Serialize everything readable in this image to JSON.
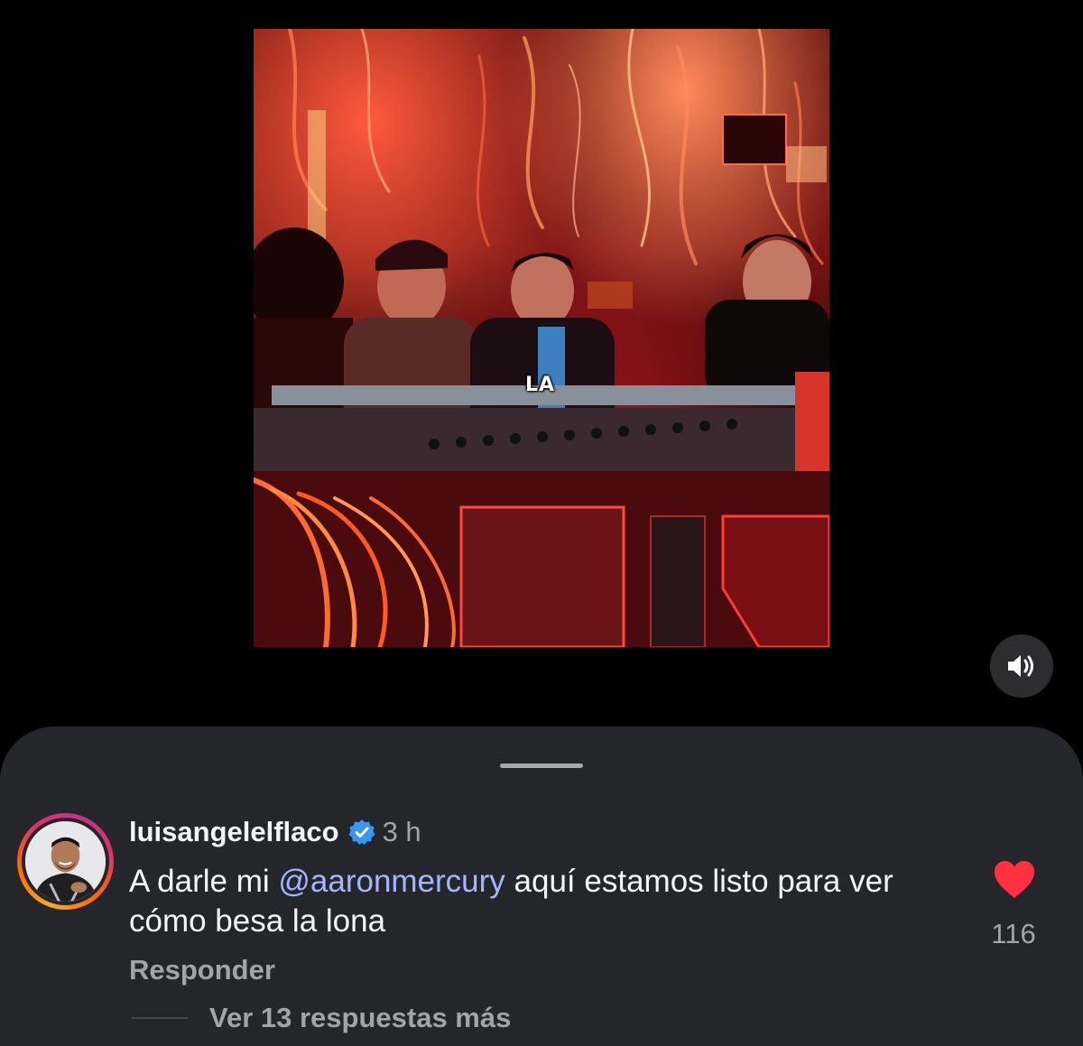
{
  "video": {
    "caption_word": "LA",
    "sound_icon": "speaker-volume-icon"
  },
  "comment": {
    "avatar_icon": "user-avatar",
    "username": "luisangelelflaco",
    "verified_icon": "verified-badge-icon",
    "timestamp": "3 h",
    "text_before": "A darle mi ",
    "mention": "@aaronmercury",
    "text_after": " aquí estamos listo para ver cómo besa la lona",
    "like_icon": "heart-icon",
    "like_color": "#ff3040",
    "like_count": "116",
    "reply_label": "Responder",
    "view_replies_label": "Ver 13 respuestas más"
  },
  "colors": {
    "sheet_background": "#25262b",
    "mention": "#a3b6ff",
    "muted_text": "#a3a4a8"
  }
}
